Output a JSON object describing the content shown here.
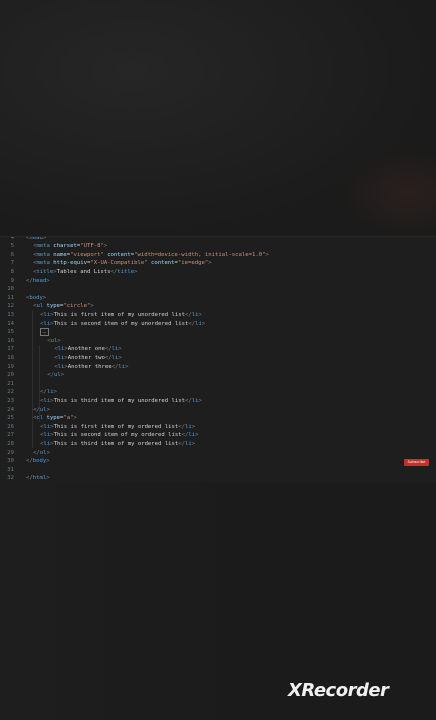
{
  "editor": {
    "lines": [
      {
        "num": "4",
        "indent": 0,
        "parts": [
          [
            "p",
            "<"
          ],
          [
            "t",
            "head"
          ],
          [
            "p",
            ">"
          ]
        ]
      },
      {
        "num": "5",
        "indent": 2,
        "parts": [
          [
            "p",
            "<"
          ],
          [
            "t",
            "meta "
          ],
          [
            "a",
            "charset"
          ],
          [
            "txt",
            "="
          ],
          [
            "s",
            "\"UTF-8\""
          ],
          [
            "p",
            ">"
          ]
        ]
      },
      {
        "num": "6",
        "indent": 2,
        "parts": [
          [
            "p",
            "<"
          ],
          [
            "t",
            "meta "
          ],
          [
            "a",
            "name"
          ],
          [
            "txt",
            "="
          ],
          [
            "s",
            "\"viewport\" "
          ],
          [
            "a",
            "content"
          ],
          [
            "txt",
            "="
          ],
          [
            "s",
            "\"width=device-width, initial-scale=1.0\""
          ],
          [
            "p",
            ">"
          ]
        ]
      },
      {
        "num": "7",
        "indent": 2,
        "parts": [
          [
            "p",
            "<"
          ],
          [
            "t",
            "meta "
          ],
          [
            "a",
            "http-equiv"
          ],
          [
            "txt",
            "="
          ],
          [
            "s",
            "\"X-UA-Compatible\" "
          ],
          [
            "a",
            "content"
          ],
          [
            "txt",
            "="
          ],
          [
            "s",
            "\"ie=edge\""
          ],
          [
            "p",
            ">"
          ]
        ]
      },
      {
        "num": "8",
        "indent": 2,
        "parts": [
          [
            "p",
            "<"
          ],
          [
            "t",
            "title"
          ],
          [
            "p",
            ">"
          ],
          [
            "txt",
            "Tables and Lists"
          ],
          [
            "p",
            "</"
          ],
          [
            "t",
            "title"
          ],
          [
            "p",
            ">"
          ]
        ]
      },
      {
        "num": "9",
        "indent": 0,
        "parts": [
          [
            "p",
            "</"
          ],
          [
            "t",
            "head"
          ],
          [
            "p",
            ">"
          ]
        ]
      },
      {
        "num": "10",
        "indent": 0,
        "parts": []
      },
      {
        "num": "11",
        "indent": 0,
        "parts": [
          [
            "p",
            "<"
          ],
          [
            "t",
            "body"
          ],
          [
            "p",
            ">"
          ]
        ]
      },
      {
        "num": "12",
        "indent": 2,
        "parts": [
          [
            "p",
            "<"
          ],
          [
            "t",
            "ul "
          ],
          [
            "a",
            "type"
          ],
          [
            "txt",
            "="
          ],
          [
            "s",
            "\"circle\""
          ],
          [
            "p",
            ">"
          ]
        ]
      },
      {
        "num": "13",
        "indent": 4,
        "parts": [
          [
            "p",
            "<"
          ],
          [
            "t",
            "li"
          ],
          [
            "p",
            ">"
          ],
          [
            "txt",
            "This is first item of my unordered list"
          ],
          [
            "p",
            "</"
          ],
          [
            "t",
            "li"
          ],
          [
            "p",
            ">"
          ]
        ]
      },
      {
        "num": "14",
        "indent": 4,
        "parts": [
          [
            "p",
            "<"
          ],
          [
            "t",
            "li"
          ],
          [
            "p",
            ">"
          ],
          [
            "txt",
            "This is second item of my unordered list"
          ],
          [
            "p",
            "</"
          ],
          [
            "t",
            "li"
          ],
          [
            "p",
            ">"
          ]
        ]
      },
      {
        "num": "15",
        "indent": 4,
        "fold": true,
        "parts": []
      },
      {
        "num": "16",
        "indent": 6,
        "parts": [
          [
            "p",
            "<"
          ],
          [
            "t",
            "ul"
          ],
          [
            "p",
            ">"
          ]
        ]
      },
      {
        "num": "17",
        "indent": 8,
        "parts": [
          [
            "p",
            "<"
          ],
          [
            "t",
            "li"
          ],
          [
            "p",
            ">"
          ],
          [
            "txt",
            "Another one"
          ],
          [
            "p",
            "</"
          ],
          [
            "t",
            "li"
          ],
          [
            "p",
            ">"
          ]
        ]
      },
      {
        "num": "18",
        "indent": 8,
        "parts": [
          [
            "p",
            "<"
          ],
          [
            "t",
            "li"
          ],
          [
            "p",
            ">"
          ],
          [
            "txt",
            "Another two"
          ],
          [
            "p",
            "</"
          ],
          [
            "t",
            "li"
          ],
          [
            "p",
            ">"
          ]
        ]
      },
      {
        "num": "19",
        "indent": 8,
        "parts": [
          [
            "p",
            "<"
          ],
          [
            "t",
            "li"
          ],
          [
            "p",
            ">"
          ],
          [
            "txt",
            "Another three"
          ],
          [
            "p",
            "</"
          ],
          [
            "t",
            "li"
          ],
          [
            "p",
            ">"
          ]
        ]
      },
      {
        "num": "20",
        "indent": 6,
        "parts": [
          [
            "p",
            "</"
          ],
          [
            "t",
            "ul"
          ],
          [
            "p",
            ">"
          ]
        ]
      },
      {
        "num": "21",
        "indent": 0,
        "parts": []
      },
      {
        "num": "22",
        "indent": 4,
        "parts": [
          [
            "p",
            "</"
          ],
          [
            "t",
            "li"
          ],
          [
            "p",
            ">"
          ]
        ]
      },
      {
        "num": "23",
        "indent": 4,
        "parts": [
          [
            "p",
            "<"
          ],
          [
            "t",
            "li"
          ],
          [
            "p",
            ">"
          ],
          [
            "txt",
            "This is third item of my unordered list"
          ],
          [
            "p",
            "</"
          ],
          [
            "t",
            "li"
          ],
          [
            "p",
            ">"
          ]
        ]
      },
      {
        "num": "24",
        "indent": 2,
        "parts": [
          [
            "p",
            "</"
          ],
          [
            "t",
            "ul"
          ],
          [
            "p",
            ">"
          ]
        ]
      },
      {
        "num": "25",
        "indent": 2,
        "parts": [
          [
            "p",
            "<"
          ],
          [
            "t",
            "ol "
          ],
          [
            "a",
            "type"
          ],
          [
            "txt",
            "="
          ],
          [
            "s",
            "\"a\""
          ],
          [
            "p",
            ">"
          ]
        ]
      },
      {
        "num": "26",
        "indent": 4,
        "parts": [
          [
            "p",
            "<"
          ],
          [
            "t",
            "li"
          ],
          [
            "p",
            ">"
          ],
          [
            "txt",
            "This is first item of my ordered list"
          ],
          [
            "p",
            "</"
          ],
          [
            "t",
            "li"
          ],
          [
            "p",
            ">"
          ]
        ]
      },
      {
        "num": "27",
        "indent": 4,
        "parts": [
          [
            "p",
            "<"
          ],
          [
            "t",
            "li"
          ],
          [
            "p",
            ">"
          ],
          [
            "txt",
            "This is second item of my ordered list"
          ],
          [
            "p",
            "</"
          ],
          [
            "t",
            "li"
          ],
          [
            "p",
            ">"
          ]
        ]
      },
      {
        "num": "28",
        "indent": 4,
        "parts": [
          [
            "p",
            "<"
          ],
          [
            "t",
            "li"
          ],
          [
            "p",
            ">"
          ],
          [
            "txt",
            "This is third item of my ordered list"
          ],
          [
            "p",
            "</"
          ],
          [
            "t",
            "li"
          ],
          [
            "p",
            ">"
          ]
        ]
      },
      {
        "num": "29",
        "indent": 2,
        "parts": [
          [
            "p",
            "</"
          ],
          [
            "t",
            "ol"
          ],
          [
            "p",
            ">"
          ]
        ]
      },
      {
        "num": "30",
        "indent": 0,
        "parts": [
          [
            "p",
            "</"
          ],
          [
            "t",
            "body"
          ],
          [
            "p",
            ">"
          ]
        ]
      },
      {
        "num": "31",
        "indent": 0,
        "parts": []
      },
      {
        "num": "32",
        "indent": 0,
        "parts": [
          [
            "p",
            "</"
          ],
          [
            "t",
            "html"
          ],
          [
            "p",
            ">"
          ]
        ]
      }
    ]
  },
  "overlay": {
    "subscribe_label": "Subscribe"
  },
  "watermark": {
    "text": "XRecorder"
  },
  "colors": {
    "tag": "#569cd6",
    "attribute": "#9cdcfe",
    "string": "#ce9178",
    "text": "#d4d4d4",
    "line_number": "#6e7681",
    "editor_bg": "#1e1e1e",
    "page_bg": "#1b1b1b",
    "badge": "#c4302b"
  }
}
